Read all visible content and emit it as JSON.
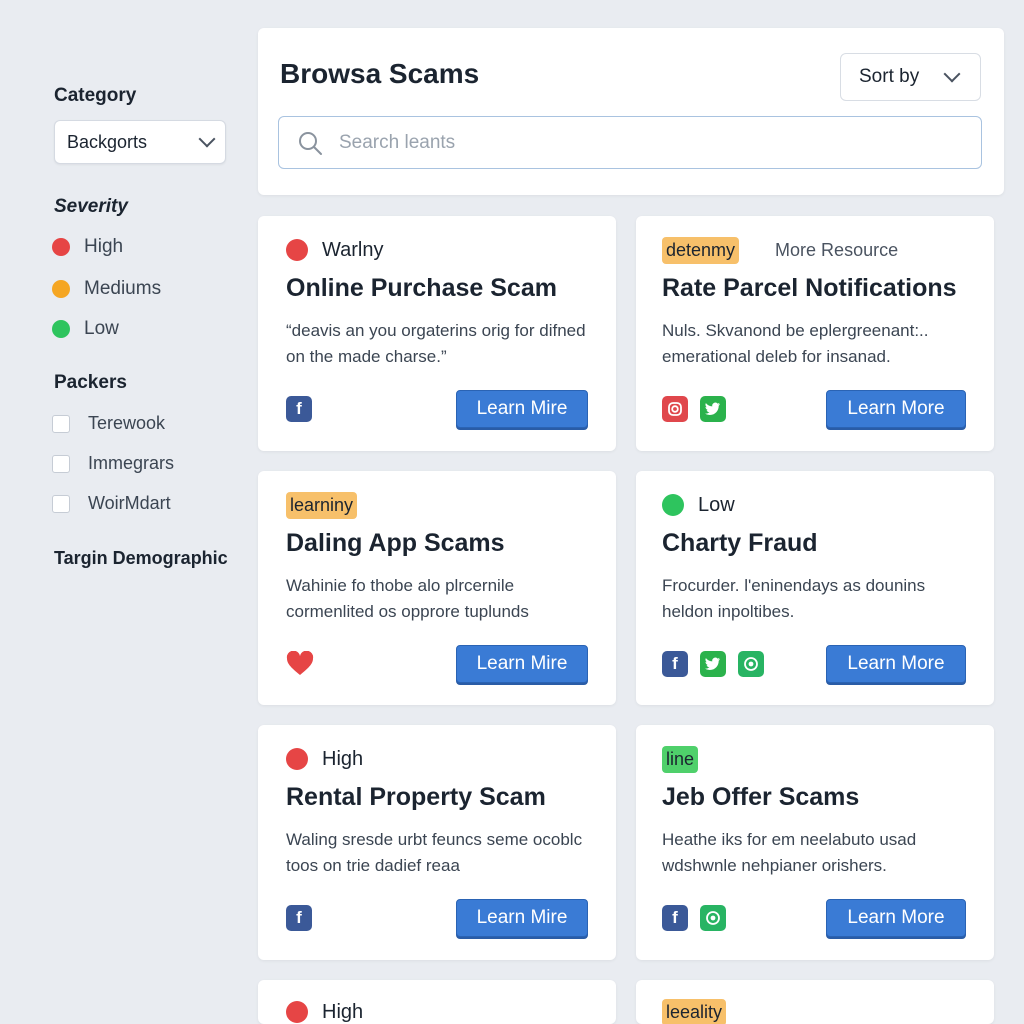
{
  "sidebar": {
    "category_heading": "Category",
    "category_value": "Backgorts",
    "severity_heading": "Severity",
    "severity": [
      {
        "label": "High",
        "color": "#e64545"
      },
      {
        "label": "Mediums",
        "color": "#f5a623"
      },
      {
        "label": "Low",
        "color": "#2ec45e"
      }
    ],
    "packers_heading": "Packers",
    "packers": [
      "Terewook",
      "Immegrars",
      "WoirMdart"
    ],
    "target_heading": "Targin Demographic"
  },
  "header": {
    "title": "Browsa Scams",
    "sort_label": "Sort by",
    "search_placeholder": "Search leants"
  },
  "cards": [
    {
      "badge": "Warlny",
      "badge_type": "dot",
      "badge_color": "#e64545",
      "title": "Online Purchase Scam",
      "desc": "“deavis an you orgaterins orig for difned on the made charse.”",
      "icons": [
        "facebook-icon"
      ],
      "button": "Learn Mire"
    },
    {
      "badge": "detenmy",
      "badge_type": "tag-orange",
      "extra": "More Resource",
      "title": "Rate Parcel Notifications",
      "desc": "Nuls. Skvanond be eplergreenant:.. emerational deleb for insanad.",
      "icons": [
        "instagram-icon",
        "twitter-icon"
      ],
      "button": "Learn More"
    },
    {
      "badge": "learniny",
      "badge_type": "tag-orange",
      "title": "Daling App Scams",
      "desc": "Wahinie fo thobe alo plrcernile cormenlited os opprore tuplunds",
      "icons": [
        "heart-icon"
      ],
      "button": "Learn Mire"
    },
    {
      "badge": "Low",
      "badge_type": "dot",
      "badge_color": "#2ec45e",
      "title": "Charty Fraud",
      "desc": "Frocurder. l'eninendays as dounins heldon inpoltibes.",
      "icons": [
        "facebook-icon",
        "twitter-icon",
        "whatsapp-icon"
      ],
      "button": "Learn More"
    },
    {
      "badge": "High",
      "badge_type": "dot",
      "badge_color": "#e64545",
      "title": "Rental Property Scam",
      "desc": "Waling sresde urbt feuncs seme ocoblc toos on trie dadief reaa",
      "icons": [
        "facebook-icon"
      ],
      "button": "Learn Mire"
    },
    {
      "badge": "line",
      "badge_type": "tag-green",
      "title": "Jeb Offer Scams",
      "desc": "Heathe iks for em neelabuto usad wdshwnle nehpianer orishers.",
      "icons": [
        "facebook-icon",
        "whatsapp-icon"
      ],
      "button": "Learn More"
    },
    {
      "badge": "High",
      "badge_type": "dot",
      "badge_color": "#e64545"
    },
    {
      "badge": "leeality",
      "badge_type": "tag-orange"
    }
  ]
}
